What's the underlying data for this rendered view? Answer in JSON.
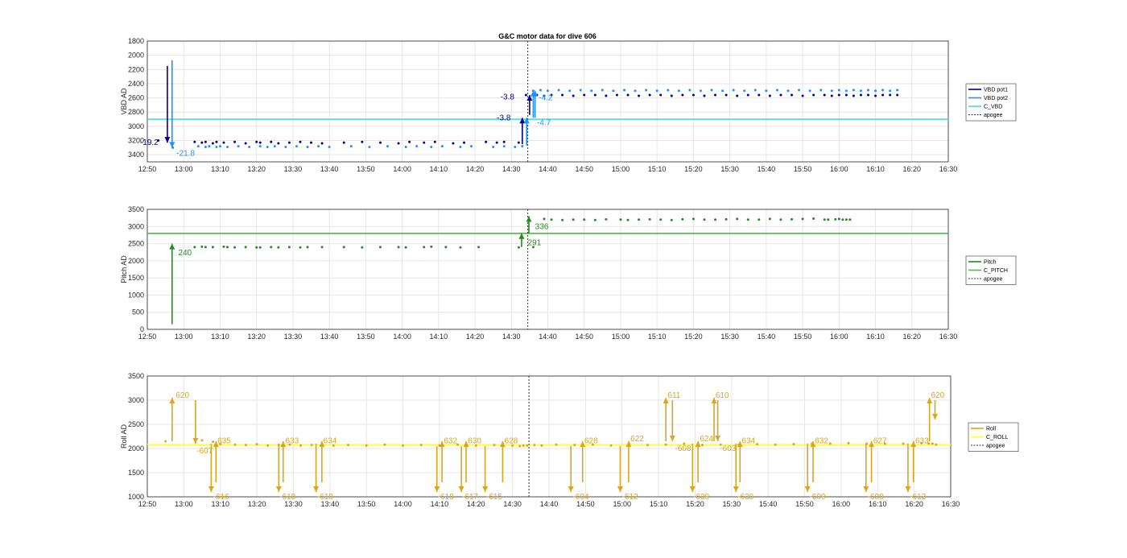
{
  "figure_title": "G&C motor data for dive 606",
  "time_ticks": [
    "12:50",
    "13:00",
    "13:10",
    "13:20",
    "13:30",
    "13:40",
    "13:50",
    "14:00",
    "14:10",
    "14:20",
    "14:30",
    "14:40",
    "14:50",
    "15:00",
    "15:10",
    "15:20",
    "15:30",
    "15:40",
    "15:50",
    "16:00",
    "16:10",
    "16:20",
    "16:30"
  ],
  "colors": {
    "vbd_pot1": "#00008b",
    "vbd_pot2": "#1e90ff",
    "c_vbd": "#40e0e0",
    "pitch": "#228b22",
    "c_pitch": "#32cd32",
    "roll": "#daa520",
    "c_roll": "#ffff40",
    "apogee": "#333333"
  },
  "chart_data": [
    {
      "type": "scatter",
      "panel": "vbd",
      "ylabel": "VBD AD",
      "ylim": [
        1800,
        3500
      ],
      "y_reversed": true,
      "y_ticks": [
        1800,
        2000,
        2200,
        2400,
        2600,
        2800,
        3000,
        3200,
        3400
      ],
      "xlim": [
        0,
        220
      ],
      "apogee_x": 104.5,
      "reference": {
        "name": "C_VBD",
        "value": 2900
      },
      "legend": [
        "VBD pot1",
        "VBD pot2",
        "C_VBD",
        "apogee"
      ],
      "series": [
        {
          "name": "VBD pot1",
          "x": [
            3,
            13,
            15,
            16,
            18,
            19,
            21,
            24,
            27,
            30,
            31,
            34,
            36,
            39,
            42,
            45,
            48,
            54,
            59,
            64,
            69,
            72,
            76,
            79,
            84,
            87,
            93,
            96,
            98,
            102,
            104,
            107,
            109,
            111,
            114,
            117,
            120,
            123,
            126,
            129,
            132,
            135,
            138,
            141,
            144,
            147,
            150,
            153,
            156,
            159,
            162,
            165,
            168,
            171,
            174,
            177,
            180,
            183,
            186,
            188,
            190,
            192,
            194,
            196,
            198,
            200,
            202,
            204,
            206
          ],
          "y": [
            3200,
            3220,
            3230,
            3220,
            3240,
            3220,
            3230,
            3220,
            3240,
            3220,
            3230,
            3220,
            3240,
            3230,
            3220,
            3230,
            3240,
            3230,
            3220,
            3230,
            3240,
            3220,
            3230,
            3220,
            3240,
            3230,
            3220,
            3230,
            3220,
            3230,
            2560,
            2560,
            2570,
            2560,
            2560,
            2570,
            2560,
            2560,
            2570,
            2560,
            2560,
            2570,
            2560,
            2560,
            2570,
            2560,
            2560,
            2570,
            2560,
            2560,
            2570,
            2560,
            2560,
            2570,
            2560,
            2560,
            2570,
            2560,
            2560,
            2570,
            2560,
            2560,
            2570,
            2560,
            2560,
            2570,
            2560,
            2560,
            2560
          ]
        },
        {
          "name": "VBD pot2",
          "x": [
            7,
            14,
            16,
            17,
            19,
            20,
            22,
            25,
            28,
            31,
            33,
            35,
            38,
            41,
            44,
            47,
            50,
            56,
            61,
            66,
            71,
            74,
            78,
            81,
            86,
            89,
            95,
            98,
            101,
            103,
            106,
            108,
            110,
            113,
            116,
            119,
            122,
            125,
            128,
            131,
            134,
            137,
            140,
            143,
            146,
            149,
            152,
            155,
            158,
            161,
            164,
            167,
            170,
            173,
            176,
            179,
            182,
            185,
            188,
            190,
            192,
            194,
            196,
            198,
            200,
            202,
            204,
            206
          ],
          "y": [
            3300,
            3280,
            3290,
            3280,
            3290,
            3280,
            3290,
            3280,
            3290,
            3280,
            3290,
            3280,
            3290,
            3280,
            3290,
            3280,
            3290,
            3280,
            3290,
            3280,
            3290,
            3280,
            3290,
            3280,
            3290,
            3280,
            3290,
            3280,
            3290,
            3280,
            2500,
            2490,
            2500,
            2490,
            2500,
            2490,
            2500,
            2490,
            2500,
            2490,
            2500,
            2490,
            2500,
            2490,
            2500,
            2490,
            2500,
            2490,
            2500,
            2490,
            2500,
            2490,
            2500,
            2490,
            2500,
            2490,
            2500,
            2490,
            2500,
            2490,
            2500,
            2490,
            2500,
            2490,
            2500,
            2490,
            2500,
            2490
          ]
        }
      ],
      "arrows": [
        {
          "series": "VBD pot1",
          "x": 5.5,
          "y0": 2150,
          "y1": 3230,
          "label": "-19.2",
          "lx": -2,
          "ly": 3230
        },
        {
          "series": "VBD pot2",
          "x": 6.8,
          "y0": 2070,
          "y1": 3300,
          "label": "-21.8",
          "lx": 8,
          "ly": 3380
        },
        {
          "series": "VBD pot1",
          "x": 103,
          "y0": 3250,
          "y1": 2880,
          "label": "-3.8",
          "lx": 96,
          "ly": 2880
        },
        {
          "series": "VBD pot1",
          "x": 105,
          "y0": 2840,
          "y1": 2560,
          "label": "-3.8",
          "lx": 97,
          "ly": 2590
        },
        {
          "series": "VBD pot2",
          "x": 104.2,
          "y0": 3270,
          "y1": 2880,
          "label": "",
          "lx": 0,
          "ly": 0
        },
        {
          "series": "VBD pot2",
          "x": 106.5,
          "y0": 2880,
          "y1": 2500,
          "label": "-4.7",
          "lx": 107,
          "ly": 2950
        },
        {
          "series": "VBD pot2",
          "x": 106,
          "y0": 2880,
          "y1": 2500,
          "label": "-4.2",
          "lx": 107.5,
          "ly": 2600
        }
      ]
    },
    {
      "type": "scatter",
      "panel": "pitch",
      "ylabel": "Pitch AD",
      "ylim": [
        0,
        3500
      ],
      "y_ticks": [
        0,
        500,
        1000,
        1500,
        2000,
        2500,
        3000,
        3500
      ],
      "xlim": [
        0,
        220
      ],
      "apogee_x": 104.5,
      "reference": {
        "name": "C_PITCH",
        "value": 2800
      },
      "legend": [
        "Pitch",
        "C_PITCH",
        "apogee"
      ],
      "series": [
        {
          "name": "Pitch",
          "x": [
            13,
            15,
            16,
            18,
            21,
            22,
            24,
            27,
            30,
            31,
            34,
            36,
            39,
            42,
            44,
            48,
            54,
            59,
            64,
            69,
            71,
            76,
            78,
            82,
            86,
            91,
            102,
            106,
            109,
            111,
            114,
            117,
            120,
            123,
            126,
            130,
            132,
            135,
            138,
            141,
            144,
            147,
            150,
            153,
            156,
            159,
            162,
            165,
            168,
            171,
            174,
            177,
            180,
            183,
            186,
            187,
            189,
            190,
            191,
            192,
            193
          ],
          "y": [
            2400,
            2410,
            2400,
            2400,
            2410,
            2400,
            2390,
            2400,
            2390,
            2390,
            2400,
            2390,
            2400,
            2390,
            2400,
            2400,
            2400,
            2390,
            2400,
            2400,
            2390,
            2400,
            2410,
            2400,
            2390,
            2400,
            2390,
            2400,
            3220,
            3200,
            3190,
            3200,
            3200,
            3190,
            3210,
            3200,
            3190,
            3200,
            3210,
            3200,
            3190,
            3210,
            3220,
            3200,
            3200,
            3210,
            3220,
            3200,
            3200,
            3220,
            3200,
            3210,
            3220,
            3230,
            3200,
            3200,
            3210,
            3220,
            3200,
            3200,
            3200
          ]
        }
      ],
      "arrows": [
        {
          "series": "Pitch",
          "x": 6.8,
          "y0": 150,
          "y1": 2500,
          "label": "240",
          "lx": 8.5,
          "ly": 2230
        },
        {
          "series": "Pitch",
          "x": 102.8,
          "y0": 2400,
          "y1": 2800,
          "label": "291",
          "lx": 104.5,
          "ly": 2530
        },
        {
          "series": "Pitch",
          "x": 104.8,
          "y0": 2800,
          "y1": 3300,
          "label": "336",
          "lx": 106.5,
          "ly": 3000
        }
      ]
    },
    {
      "type": "scatter",
      "panel": "roll",
      "ylabel": "Roll AD",
      "ylim": [
        1000,
        3500
      ],
      "y_ticks": [
        1000,
        1500,
        2000,
        2500,
        3000,
        3500
      ],
      "xlim": [
        0,
        220
      ],
      "apogee_x": 104.5,
      "reference": {
        "name": "C_ROLL",
        "value": 2080
      },
      "legend": [
        "Roll",
        "C_ROLL",
        "apogee"
      ],
      "series": [
        {
          "name": "Roll",
          "x": [
            5,
            15,
            18,
            20,
            24,
            27,
            30,
            33,
            36,
            39,
            42,
            45,
            48,
            51,
            55,
            60,
            65,
            70,
            75,
            80,
            85,
            90,
            95,
            100,
            102,
            103,
            104,
            106,
            108,
            112,
            117,
            122,
            127,
            132,
            137,
            142,
            147,
            152,
            157,
            162,
            167,
            172,
            177,
            182,
            187,
            192,
            197,
            202,
            207,
            212,
            214,
            215,
            216
          ],
          "y": [
            2150,
            2170,
            2140,
            2090,
            2080,
            2070,
            2090,
            2060,
            2070,
            2080,
            2060,
            2070,
            2080,
            2060,
            2070,
            2060,
            2080,
            2060,
            2070,
            2060,
            2080,
            2060,
            2070,
            2060,
            2050,
            2060,
            2060,
            2070,
            2060,
            2080,
            2070,
            2080,
            2060,
            2090,
            2070,
            2080,
            2100,
            2070,
            2080,
            2080,
            2090,
            2080,
            2090,
            2100,
            2100,
            2110,
            2100,
            2100,
            2100,
            2110,
            2100,
            2100,
            2080
          ]
        }
      ],
      "arrows": [
        {
          "x": 6.8,
          "y0": 2150,
          "y1": 3050,
          "label": "620",
          "lx": 7.8,
          "ly": 3100
        },
        {
          "x": 13.2,
          "y0": 3000,
          "y1": 2100,
          "label": "-607",
          "lx": 13.5,
          "ly": 1950
        },
        {
          "x": 17.5,
          "y0": 2100,
          "y1": 1100,
          "label": "-616",
          "lx": 18,
          "ly": 1000
        },
        {
          "x": 18.8,
          "y0": 1300,
          "y1": 2150,
          "label": "635",
          "lx": 19.2,
          "ly": 2160
        },
        {
          "x": 36,
          "y0": 2100,
          "y1": 1100,
          "label": "-618",
          "lx": 36.2,
          "ly": 1000
        },
        {
          "x": 37.2,
          "y0": 1300,
          "y1": 2150,
          "label": "633",
          "lx": 37.8,
          "ly": 2160
        },
        {
          "x": 46.2,
          "y0": 2100,
          "y1": 1100,
          "label": "-618",
          "lx": 46.5,
          "ly": 1000
        },
        {
          "x": 47.8,
          "y0": 1300,
          "y1": 2150,
          "label": "634",
          "lx": 48.2,
          "ly": 2160
        },
        {
          "x": 79.3,
          "y0": 2050,
          "y1": 1100,
          "label": "-618",
          "lx": 79.5,
          "ly": 1000
        },
        {
          "x": 80.7,
          "y0": 1300,
          "y1": 2150,
          "label": "632",
          "lx": 81.2,
          "ly": 2160
        },
        {
          "x": 86,
          "y0": 2050,
          "y1": 1100,
          "label": "-617",
          "lx": 86.2,
          "ly": 1000
        },
        {
          "x": 87.3,
          "y0": 1300,
          "y1": 2150,
          "label": "630",
          "lx": 87.8,
          "ly": 2160
        },
        {
          "x": 92.5,
          "y0": 2050,
          "y1": 1100,
          "label": "-615",
          "lx": 92.8,
          "ly": 1000
        },
        {
          "x": 97.3,
          "y0": 1300,
          "y1": 2150,
          "label": "628",
          "lx": 97.8,
          "ly": 2160
        },
        {
          "x": 116,
          "y0": 2050,
          "y1": 1100,
          "label": "-604",
          "lx": 116.5,
          "ly": 1000
        },
        {
          "x": 119.2,
          "y0": 1300,
          "y1": 2150,
          "label": "628",
          "lx": 119.7,
          "ly": 2160
        },
        {
          "x": 129.5,
          "y0": 2050,
          "y1": 1100,
          "label": "-612",
          "lx": 130,
          "ly": 1000
        },
        {
          "x": 131.8,
          "y0": 1300,
          "y1": 2150,
          "label": "622",
          "lx": 132.3,
          "ly": 2200
        },
        {
          "x": 142,
          "y0": 2150,
          "y1": 3050,
          "label": "611",
          "lx": 142.5,
          "ly": 3100
        },
        {
          "x": 143.8,
          "y0": 3000,
          "y1": 2150,
          "label": "-608",
          "lx": 144.5,
          "ly": 2000
        },
        {
          "x": 149.3,
          "y0": 2100,
          "y1": 1100,
          "label": "-639",
          "lx": 149.5,
          "ly": 1000
        },
        {
          "x": 150.8,
          "y0": 1300,
          "y1": 2150,
          "label": "624",
          "lx": 151.3,
          "ly": 2200
        },
        {
          "x": 155.2,
          "y0": 2150,
          "y1": 3050,
          "label": "610",
          "lx": 155.6,
          "ly": 3100
        },
        {
          "x": 156.2,
          "y0": 3000,
          "y1": 2150,
          "label": "-603",
          "lx": 156.8,
          "ly": 2000
        },
        {
          "x": 161.2,
          "y0": 2100,
          "y1": 1100,
          "label": "-638",
          "lx": 161.6,
          "ly": 1000
        },
        {
          "x": 162.3,
          "y0": 1300,
          "y1": 2150,
          "label": "634",
          "lx": 162.8,
          "ly": 2160
        },
        {
          "x": 180.8,
          "y0": 2100,
          "y1": 1100,
          "label": "-609",
          "lx": 181.3,
          "ly": 1000
        },
        {
          "x": 182.3,
          "y0": 1300,
          "y1": 2150,
          "label": "632",
          "lx": 182.8,
          "ly": 2160
        },
        {
          "x": 196.8,
          "y0": 2100,
          "y1": 1100,
          "label": "-608",
          "lx": 197.2,
          "ly": 1000
        },
        {
          "x": 198.3,
          "y0": 1300,
          "y1": 2150,
          "label": "627",
          "lx": 198.8,
          "ly": 2160
        },
        {
          "x": 208.3,
          "y0": 2100,
          "y1": 1100,
          "label": "-612",
          "lx": 208.8,
          "ly": 1000
        },
        {
          "x": 209.8,
          "y0": 1300,
          "y1": 2150,
          "label": "633",
          "lx": 210.3,
          "ly": 2160
        },
        {
          "x": 214.2,
          "y0": 2150,
          "y1": 3050,
          "label": "620",
          "lx": 214.6,
          "ly": 3100
        },
        {
          "x": 215.7,
          "y0": 3000,
          "y1": 2600,
          "label": "",
          "lx": 0,
          "ly": 0
        }
      ]
    }
  ]
}
